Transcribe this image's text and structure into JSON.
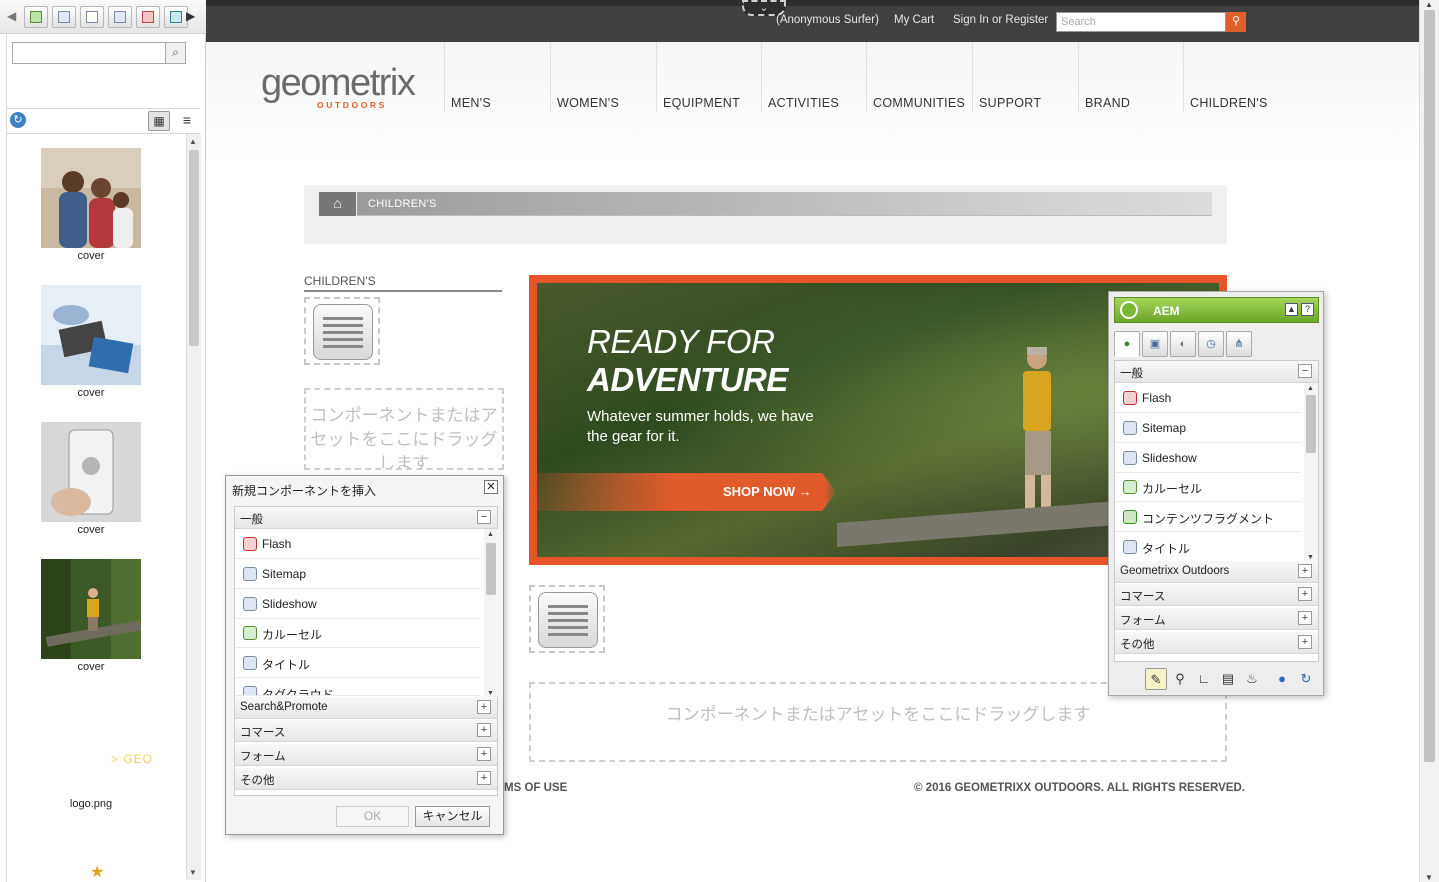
{
  "finder": {
    "tabs": [
      "images-tab",
      "documents-tab",
      "pages-tab",
      "paragraphs-tab",
      "movies-tab",
      "products-tab"
    ],
    "search": {
      "value": "",
      "placeholder": ""
    },
    "assets": [
      {
        "label": "cover"
      },
      {
        "label": "cover"
      },
      {
        "label": "cover"
      },
      {
        "label": "cover"
      },
      {
        "label": "logo.png",
        "logo_text": "> GEO"
      }
    ]
  },
  "topbar": {
    "user": "(Anonymous Surfer)",
    "cart": "My Cart",
    "signin": "Sign In or Register",
    "search_placeholder": "Search"
  },
  "logo": {
    "word": "geometrix",
    "sub": "OUTDOORS"
  },
  "nav": [
    "MEN'S",
    "WOMEN'S",
    "EQUIPMENT",
    "ACTIVITIES",
    "COMMUNITIES",
    "SUPPORT",
    "BRAND",
    "CHILDREN'S"
  ],
  "breadcrumb": {
    "current": "CHILDREN'S"
  },
  "sidebar": {
    "heading": "CHILDREN'S"
  },
  "drop_text": "コンポーネントまたはアセットをここにドラッグします",
  "banner": {
    "line1": "READY FOR",
    "line2": "ADVENTURE",
    "subline": "Whatever summer holds, we have the gear for it.",
    "cta": "SHOP NOW →"
  },
  "footer": {
    "terms": "MS OF USE",
    "copyright": "© 2016 GEOMETRIXX OUTDOORS. ALL RIGHTS RESERVED."
  },
  "dialog": {
    "title": "新規コンポーネントを挿入",
    "group_open": "一般",
    "components": [
      "Flash",
      "Sitemap",
      "Slideshow",
      "カルーセル",
      "タイトル",
      "タグクラウド"
    ],
    "groups": [
      "Search&Promote",
      "コマース",
      "フォーム",
      "その他"
    ],
    "ok": "OK",
    "cancel": "キャンセル"
  },
  "sidekick": {
    "title": "AEM",
    "group_open": "一般",
    "components": [
      "Flash",
      "Sitemap",
      "Slideshow",
      "カルーセル",
      "コンテンツフラグメント",
      "タイトル"
    ],
    "groups": [
      "Geometrixx Outdoors",
      "コマース",
      "フォーム",
      "その他"
    ]
  },
  "colors": {
    "accent": "#e0602c",
    "sidekick_green": "#7bb935",
    "topbar": "#404040"
  }
}
